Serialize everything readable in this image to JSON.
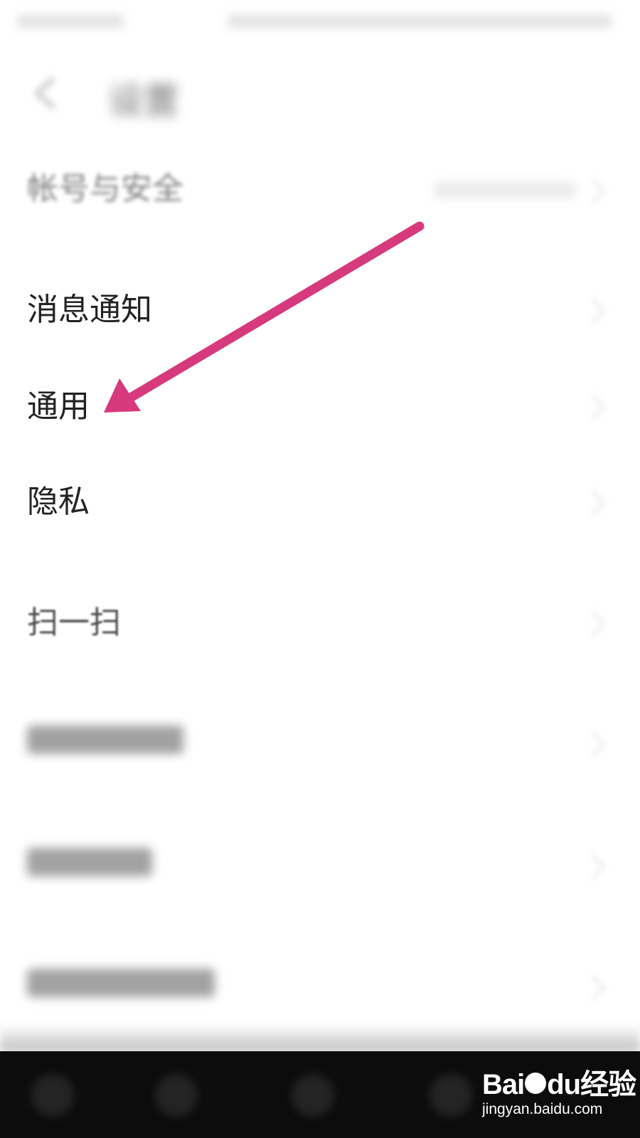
{
  "header": {
    "title": "设置",
    "back_icon": "chevron-left-icon"
  },
  "settings": {
    "items": [
      {
        "label": "帐号与安全"
      },
      {
        "label": "消息通知"
      },
      {
        "label": "通用"
      },
      {
        "label": "隐私"
      },
      {
        "label": "扫一扫"
      }
    ]
  },
  "annotation": {
    "arrow_color": "#d63a7c",
    "points_to": "通用"
  },
  "watermark": {
    "logo": "Bai●du 经验",
    "logo_left": "Bai",
    "logo_right": "du经验",
    "url": "jingyan.baidu.com"
  },
  "colors": {
    "background": "#ffffff",
    "nav_bar": "#0c0c0c",
    "text": "#222222"
  }
}
